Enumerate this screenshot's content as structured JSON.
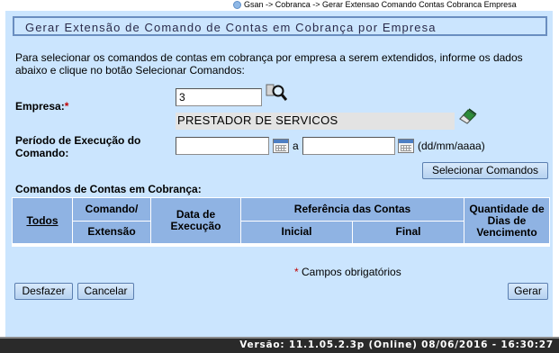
{
  "breadcrumb": {
    "text": "Gsan -> Cobranca -> Gerar Extensao Comando Contas Cobranca Empresa"
  },
  "page": {
    "title": "Gerar Extensão de Comando de Contas em Cobrança por Empresa"
  },
  "intro": {
    "text": "Para selecionar os comandos de contas em cobrança por empresa a serem extendidos, informe os dados abaixo e clique no botão Selecionar Comandos:"
  },
  "form": {
    "empresa_label": "Empresa:",
    "required_mark": "*",
    "empresa_value": "3",
    "empresa_name": "PRESTADOR DE SERVICOS",
    "periodo_label_line1": "Período de Execução do",
    "periodo_label_line2": "Comando:",
    "periodo_inicio": "",
    "periodo_fim": "",
    "separator": "a",
    "date_format": "(dd/mm/aaaa)",
    "select_button": "Selecionar Comandos"
  },
  "table": {
    "section_title": "Comandos de Contas em Cobrança:",
    "headers": {
      "todos": "Todos",
      "comando": "Comando/",
      "extensao": "Extensão",
      "data_line1": "Data de",
      "data_line2": "Execução",
      "referencia": "Referência das Contas",
      "inicial": "Inicial",
      "final": "Final",
      "qtd_line1": "Quantidade de",
      "qtd_line2": "Dias de",
      "qtd_line3": "Vencimento"
    }
  },
  "note": {
    "mark": "*",
    "text": " Campos obrigatórios"
  },
  "buttons": {
    "desfazer": "Desfazer",
    "cancelar": "Cancelar",
    "gerar": "Gerar"
  },
  "footer": {
    "version": "Versão: 11.1.05.2.3p (Online) 08/06/2016 - 16:30:27"
  },
  "colors": {
    "panel": "#cbe5fe",
    "table_header": "#8fb3e3",
    "required": "#c00000",
    "footer": "#2a2a2a"
  }
}
